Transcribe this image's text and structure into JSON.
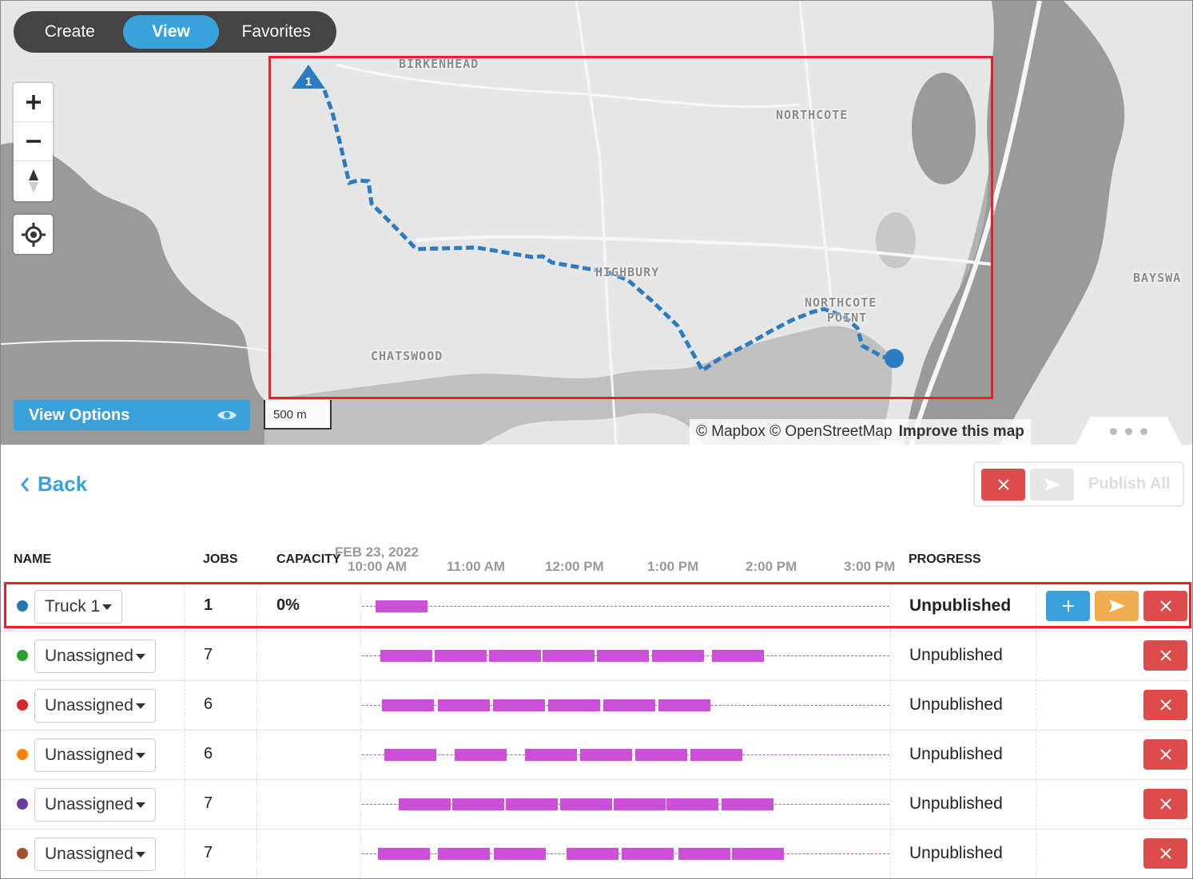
{
  "mode_tabs": [
    {
      "label": "Create",
      "active": false
    },
    {
      "label": "View",
      "active": true
    },
    {
      "label": "Favorites",
      "active": false
    }
  ],
  "map": {
    "places": [
      "BIRKENHEAD",
      "NORTHCOTE",
      "HIGHBURY",
      "NORTHCOTE",
      "POINT",
      "CHATSWOOD",
      "BAYSWA"
    ],
    "route_start_marker": "1",
    "view_options_label": "View Options",
    "scale_label": "500 m",
    "attribution": "© Mapbox © OpenStreetMap",
    "improve_link": "Improve this map"
  },
  "panel": {
    "back_label": "Back",
    "publish_all_label": "Publish All",
    "date_label": "FEB 23, 2022",
    "columns": {
      "name": "NAME",
      "jobs": "JOBS",
      "capacity": "CAPACITY",
      "progress": "PROGRESS"
    },
    "time_ticks": [
      "10:00 AM",
      "11:00 AM",
      "12:00 PM",
      "1:00 PM",
      "2:00 PM",
      "3:00 PM"
    ],
    "rows": [
      {
        "color": "#1f77b4",
        "name": "Truck 1",
        "jobs": "1",
        "capacity": "0%",
        "progress": "Unpublished",
        "selected": true,
        "segments": [
          [
            0.0,
            0.0
          ]
        ]
      },
      {
        "color": "#2ca02c",
        "name": "Unassigned",
        "jobs": "7",
        "capacity": "",
        "progress": "Unpublished",
        "selected": false
      },
      {
        "color": "#d62728",
        "name": "Unassigned",
        "jobs": "6",
        "capacity": "",
        "progress": "Unpublished",
        "selected": false
      },
      {
        "color": "#ff7f0e",
        "name": "Unassigned",
        "jobs": "6",
        "capacity": "",
        "progress": "Unpublished",
        "selected": false
      },
      {
        "color": "#6a3d9a",
        "name": "Unassigned",
        "jobs": "7",
        "capacity": "",
        "progress": "Unpublished",
        "selected": false
      },
      {
        "color": "#a0522d",
        "name": "Unassigned",
        "jobs": "7",
        "capacity": "",
        "progress": "Unpublished",
        "selected": false
      }
    ]
  },
  "colors": {
    "accent": "#3aa2db",
    "danger": "#dd4b4b",
    "warning": "#f0ad4e",
    "job_bar": "#cc4fd8",
    "highlight": "#e8202a"
  }
}
